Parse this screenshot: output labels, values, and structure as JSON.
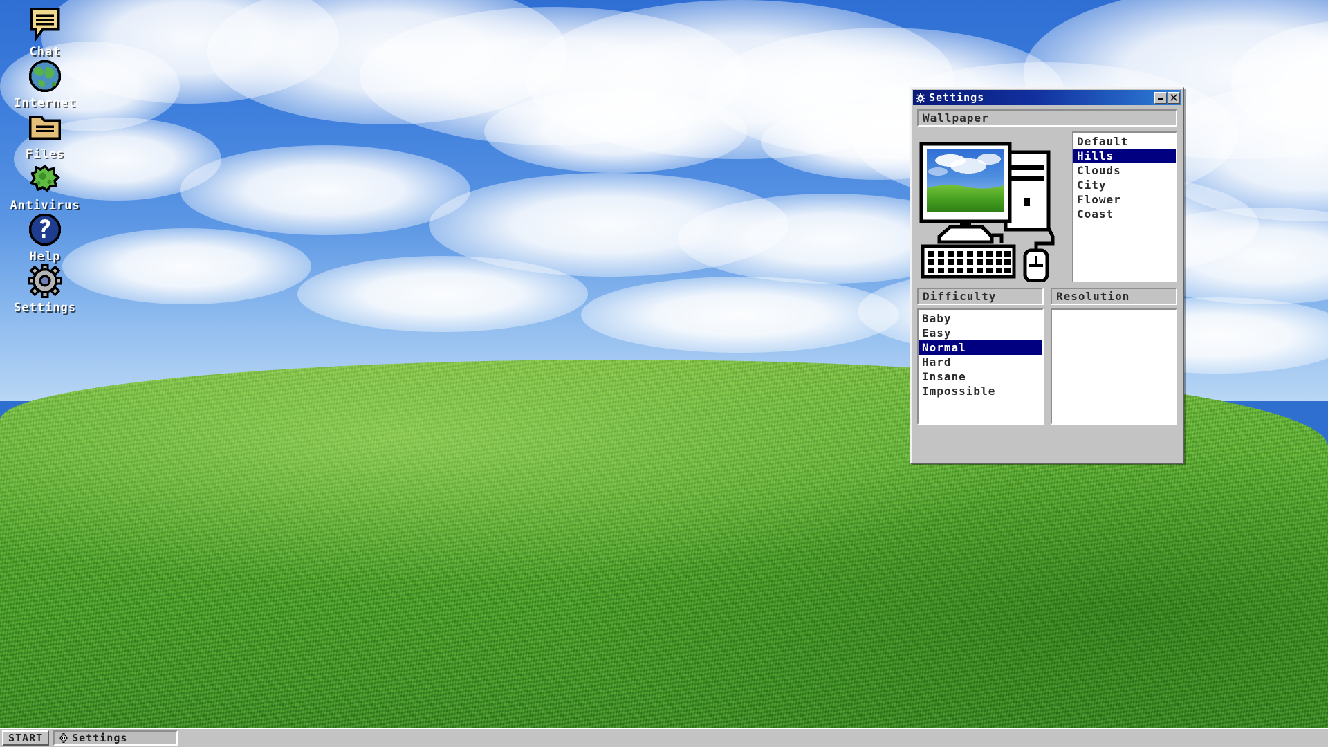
{
  "desktop": {
    "icons": [
      {
        "label": "Chat",
        "icon": "chat-bubble-icon"
      },
      {
        "label": "Internet",
        "icon": "globe-icon"
      },
      {
        "label": "Files",
        "icon": "folder-icon"
      },
      {
        "label": "Antivirus",
        "icon": "germ-icon"
      },
      {
        "label": "Help",
        "icon": "question-mark-sphere-icon"
      },
      {
        "label": "Settings",
        "icon": "gear-icon"
      }
    ]
  },
  "window": {
    "title": "Settings",
    "title_icon": "gear-icon",
    "minimize_label": "minimize-icon",
    "close_label": "close-icon",
    "wallpaper": {
      "header": "Wallpaper",
      "preview_icon": "computer-monitor-keyboard-mouse-icon",
      "options": [
        "Default",
        "Hills",
        "Clouds",
        "City",
        "Flower",
        "Coast"
      ],
      "selected": "Hills"
    },
    "difficulty": {
      "header": "Difficulty",
      "options": [
        "Baby",
        "Easy",
        "Normal",
        "Hard",
        "Insane",
        "Impossible"
      ],
      "selected": "Normal"
    },
    "resolution": {
      "header": "Resolution",
      "options": [],
      "selected": ""
    }
  },
  "taskbar": {
    "start_label": "START",
    "tasks": [
      {
        "label": "Settings",
        "icon": "gear-icon"
      }
    ]
  },
  "colors": {
    "titlebar_start": "#0a1a78",
    "titlebar_end": "#2f7fd8",
    "selection": "#000080",
    "face": "#c3c3c3",
    "sky": "#3c7ddc",
    "grass": "#4fa826"
  }
}
